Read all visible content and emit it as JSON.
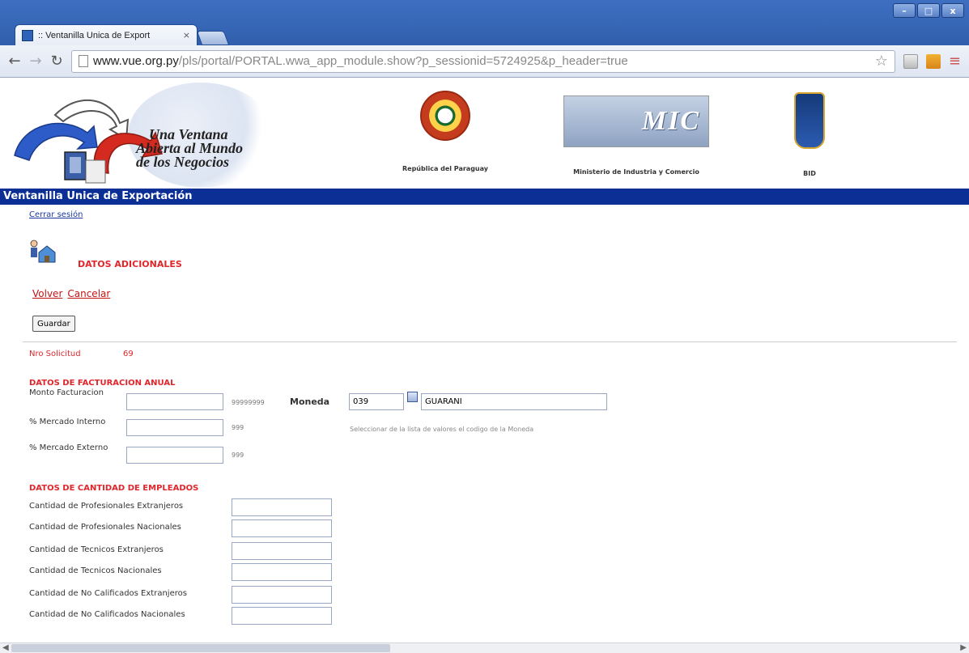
{
  "browser": {
    "tab_title": ":: Ventanilla Unica de Export",
    "tab_close": "×",
    "url_domain": "www.vue.org.py",
    "url_path": "/pls/portal/PORTAL.wwa_app_module.show?p_sessionid=5724925&p_header=true",
    "window_controls": [
      "–",
      "□",
      "x"
    ]
  },
  "header": {
    "slogan": [
      "Una Ventana",
      "Abierta al Mundo",
      "de los Negocios"
    ],
    "partners": [
      {
        "name": "República del Paraguay",
        "icon": "paraguay-seal-icon"
      },
      {
        "name": "Ministerio de Industria y Comercio",
        "icon": "mic-logo-icon",
        "logo_text": "MIC"
      },
      {
        "name": "BID",
        "icon": "bid-logo-icon"
      }
    ],
    "title": "Ventanilla Unica de Exportación"
  },
  "page": {
    "logout_link": "Cerrar sesión",
    "section_title": "DATOS ADICIONALES",
    "nav_links": [
      "Volver",
      "Cancelar"
    ],
    "save_button": "Guardar",
    "nro_solicitud_label": "Nro Solicitud",
    "nro_solicitud_value": "69"
  },
  "facturacion": {
    "heading": "DATOS DE FACTURACION ANUAL",
    "fields": [
      {
        "label": "Monto Facturacion",
        "value": "",
        "mask": "99999999"
      },
      {
        "label": "% Mercado Interno",
        "value": "",
        "mask": "999"
      },
      {
        "label": "% Mercado Externo",
        "value": "",
        "mask": "999"
      }
    ],
    "moneda_label": "Moneda",
    "moneda_code": "039",
    "moneda_name": "GUARANI",
    "moneda_help": "Seleccionar de la lista de valores el codigo de la Moneda"
  },
  "empleados": {
    "heading": "DATOS DE CANTIDAD DE EMPLEADOS",
    "fields": [
      {
        "label": "Cantidad de Profesionales Extranjeros",
        "value": ""
      },
      {
        "label": "Cantidad de Profesionales Nacionales",
        "value": ""
      },
      {
        "label": "Cantidad de Tecnicos Extranjeros",
        "value": ""
      },
      {
        "label": "Cantidad de Tecnicos Nacionales",
        "value": ""
      },
      {
        "label": "Cantidad de No Calificados Extranjeros",
        "value": ""
      },
      {
        "label": "Cantidad de No Calificados Nacionales",
        "value": ""
      }
    ]
  },
  "colors": {
    "title_bar": "#0b2f95",
    "accent_red": "#e0262b",
    "link_blue": "#1b3aa0"
  }
}
